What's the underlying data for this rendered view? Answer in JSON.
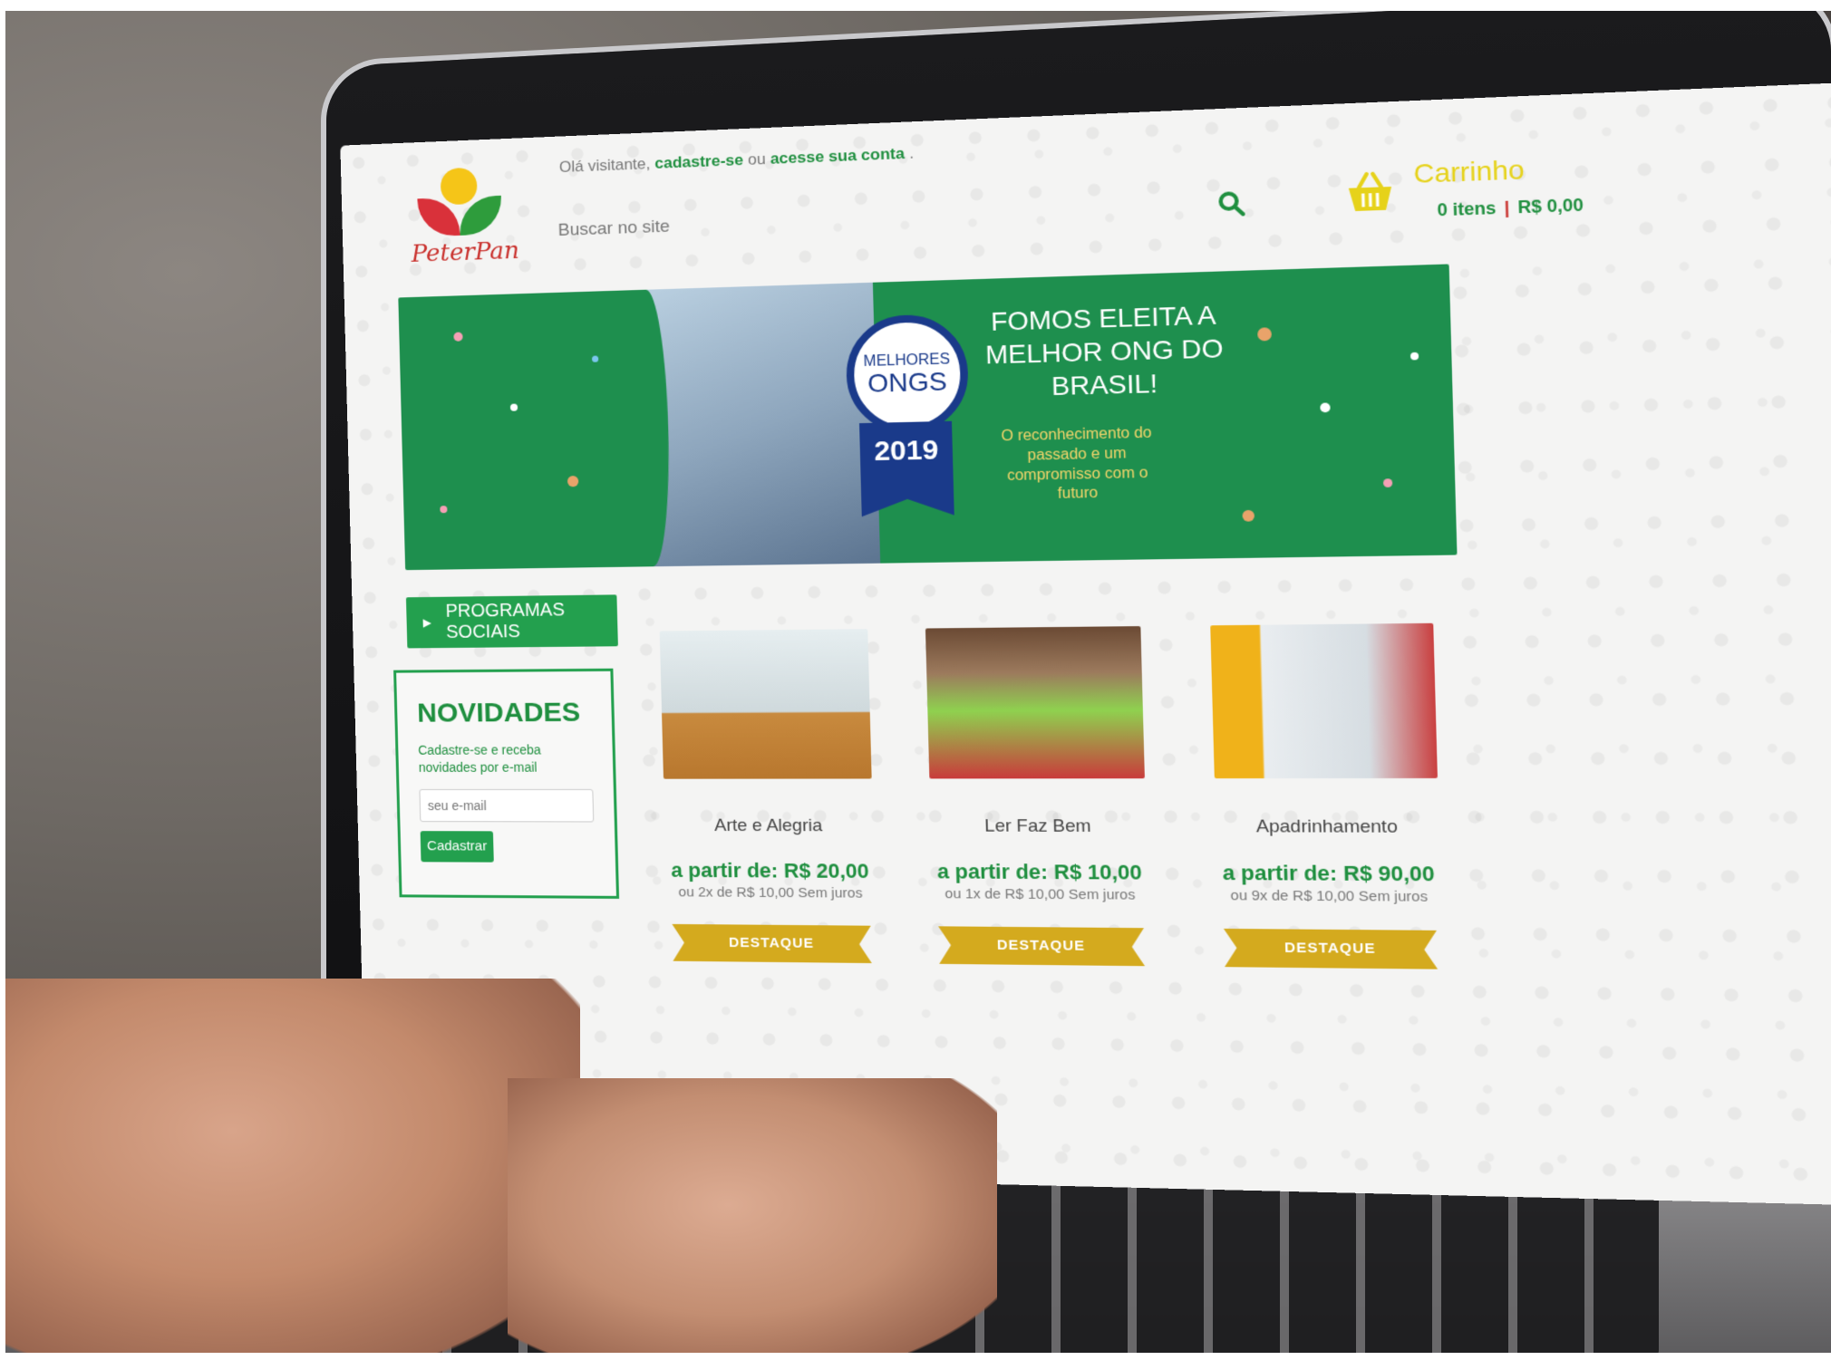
{
  "header": {
    "logo_text": "PeterPan",
    "greeting_prefix": "Olá visitante,",
    "signup_link": "cadastre-se",
    "greeting_or": "ou",
    "login_link": "acesse sua conta",
    "greeting_suffix": ".",
    "search_placeholder": "Buscar no site",
    "cart_title": "Carrinho",
    "cart_items": "0 itens",
    "cart_separator": "|",
    "cart_total": "R$ 0,00"
  },
  "banner": {
    "badge_line1": "MELHORES",
    "badge_line2": "ONGS",
    "badge_year": "2019",
    "headline": "FOMOS ELEITA A MELHOR ONG DO BRASIL!",
    "subtext": "O reconhecimento do passado e um compromisso com o futuro"
  },
  "sidebar": {
    "programs_label": "PROGRAMAS SOCIAIS",
    "news_title": "NOVIDADES",
    "news_text": "Cadastre-se e receba novidades por e-mail",
    "email_placeholder": "seu e-mail",
    "submit_label": "Cadastrar"
  },
  "products": [
    {
      "name": "Arte e Alegria",
      "price": "a partir de: R$ 20,00",
      "installments": "ou 2x de R$ 10,00 Sem juros",
      "tag": "DESTAQUE"
    },
    {
      "name": "Ler Faz Bem",
      "price": "a partir de: R$ 10,00",
      "installments": "ou 1x de R$ 10,00 Sem juros",
      "tag": "DESTAQUE"
    },
    {
      "name": "Apadrinhamento",
      "price": "a partir de: R$ 90,00",
      "installments": "ou 9x de R$ 10,00 Sem juros",
      "tag": "DESTAQUE"
    }
  ],
  "colors": {
    "brand_green": "#1f8f3f",
    "banner_green": "#1e8f4e",
    "button_green": "#23a04e",
    "cart_yellow": "#e6d21a",
    "tag_gold": "#d4aa1e",
    "accent_red": "#c9302c"
  },
  "icons": {
    "search": "search-icon",
    "cart": "basket-icon",
    "arrow": "play-arrow-icon"
  }
}
